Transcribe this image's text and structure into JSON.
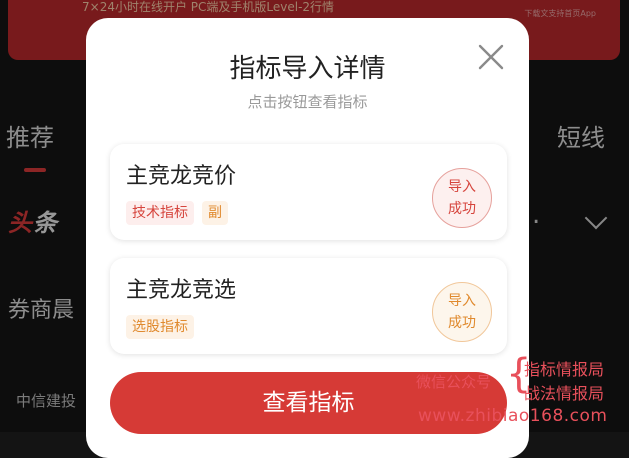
{
  "background": {
    "banner_text": "7×24小时在线开户   PC端及手机版Level-2行情",
    "banner_note": "下载文支持首页App",
    "tab_recommend": "推荐",
    "tab_short": "短线",
    "logo_x": "头",
    "logo_rest": "条",
    "section_title": "券商晨",
    "source_text": "中信建投"
  },
  "modal": {
    "title": "指标导入详情",
    "subtitle": "点击按钮查看指标",
    "cards": [
      {
        "name": "主竞龙竞价",
        "tags": [
          "技术指标",
          "副"
        ],
        "status_line1": "导入",
        "status_line2": "成功"
      },
      {
        "name": "主竞龙竞选",
        "tags": [
          "选股指标"
        ],
        "status_line1": "导入",
        "status_line2": "成功"
      }
    ],
    "primary_button": "查看指标"
  },
  "watermark": {
    "left": "微信公众号",
    "right_top": "指标情报局",
    "right_bottom": "战法情报局",
    "url": "www.zhibiao168.com"
  },
  "colors": {
    "accent": "#d63a36",
    "tag_orange": "#e08a2e",
    "watermark": "#e8505b"
  },
  "icons": {
    "close": "close-icon"
  }
}
